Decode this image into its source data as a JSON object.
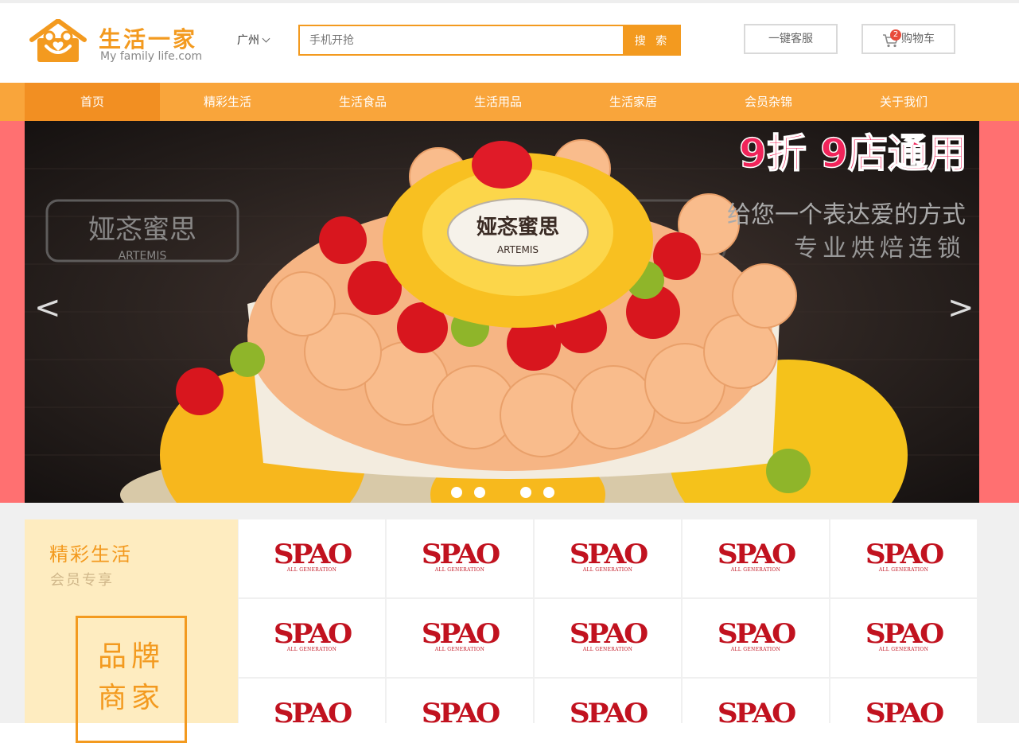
{
  "header": {
    "logo_title": "生活一家",
    "logo_subtitle": "My family life.com",
    "city": "广州",
    "search_placeholder": "手机开抢",
    "search_button": "搜 索",
    "service_button": "一键客服",
    "cart_label": "购物车",
    "cart_count": "2"
  },
  "nav": {
    "items": [
      "首页",
      "精彩生活",
      "生活食品",
      "生活用品",
      "生活家居",
      "会员杂锦",
      "关于我们"
    ],
    "active_index": 0
  },
  "banner": {
    "headline": "9折 9店通用",
    "brand_cn": "娅忞蜜思",
    "brand_en": "ARTEMIS",
    "slogan_1": "给您一个表达爱的方式",
    "slogan_2": "专业烘焙连锁",
    "prev_arrow": "<",
    "next_arrow": ">",
    "slide_count": 5,
    "active_slide": 2
  },
  "promo": {
    "title": "精彩生活",
    "subtitle": "会员专享",
    "box_line_1": "品牌",
    "box_line_2": "商家"
  },
  "brands": {
    "name": "SPAO",
    "tagline": "ALL GENERATION",
    "rows": 3,
    "cols": 5
  },
  "colors": {
    "accent": "#f39a1f",
    "nav": "#f9a53b",
    "nav_active": "#f28f22",
    "banner_side": "#ff7071",
    "brand_red": "#c1121f",
    "promo_bg": "#feecc0"
  }
}
